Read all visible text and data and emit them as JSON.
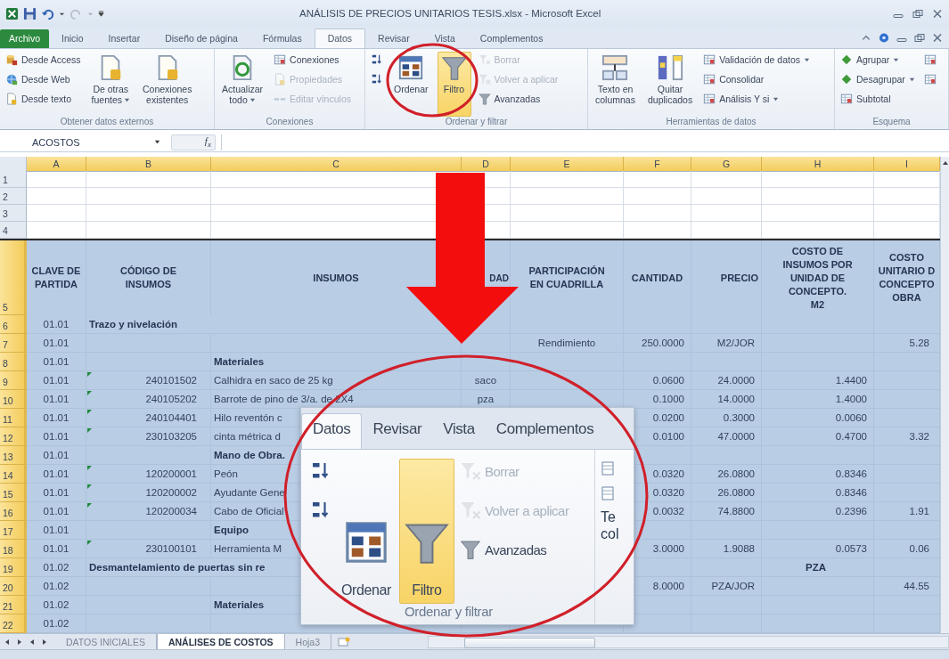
{
  "title_bar": {
    "title": "ANÁLISIS DE PRECIOS UNITARIOS TESIS.xlsx - Microsoft Excel"
  },
  "menu_tabs": [
    {
      "label": "Archivo",
      "kind": "file",
      "selected": false
    },
    {
      "label": "Inicio",
      "kind": "tab",
      "selected": false
    },
    {
      "label": "Insertar",
      "kind": "tab",
      "selected": false
    },
    {
      "label": "Diseño de página",
      "kind": "tab",
      "selected": false
    },
    {
      "label": "Fórmulas",
      "kind": "tab",
      "selected": false
    },
    {
      "label": "Datos",
      "kind": "tab",
      "selected": true
    },
    {
      "label": "Revisar",
      "kind": "tab",
      "selected": false
    },
    {
      "label": "Vista",
      "kind": "tab",
      "selected": false
    },
    {
      "label": "Complementos",
      "kind": "tab",
      "selected": false
    }
  ],
  "ribbon": [
    {
      "label": "Obtener datos externos",
      "items": [
        {
          "kind": "small",
          "label": [
            "Desde Access"
          ],
          "dropdown": false,
          "disabled": false,
          "selected": false
        },
        {
          "kind": "small",
          "label": [
            "Desde Web"
          ],
          "dropdown": false,
          "disabled": false,
          "selected": false
        },
        {
          "kind": "small",
          "label": [
            "Desde texto"
          ],
          "dropdown": false,
          "disabled": false,
          "selected": false
        },
        {
          "kind": "large",
          "label": [
            "De otras",
            "fuentes"
          ],
          "dropdown": true,
          "disabled": false,
          "selected": false
        },
        {
          "kind": "large",
          "label": [
            "Conexiones",
            "existentes"
          ],
          "dropdown": false,
          "disabled": false,
          "selected": false
        }
      ]
    },
    {
      "label": "Conexiones",
      "items": [
        {
          "kind": "large",
          "label": [
            "Actualizar",
            "todo"
          ],
          "dropdown": true,
          "disabled": false,
          "selected": false
        },
        {
          "kind": "small",
          "label": [
            "Conexiones"
          ],
          "dropdown": false,
          "disabled": false,
          "selected": false
        },
        {
          "kind": "small",
          "label": [
            "Propiedades"
          ],
          "dropdown": false,
          "disabled": true,
          "selected": false
        },
        {
          "kind": "small",
          "label": [
            "Editar vínculos"
          ],
          "dropdown": false,
          "disabled": true,
          "selected": false
        }
      ]
    },
    {
      "label": "Ordenar y filtrar",
      "items": [
        {
          "kind": "icon",
          "dropdown": false,
          "disabled": false,
          "selected": false
        },
        {
          "kind": "icon",
          "dropdown": false,
          "disabled": false,
          "selected": false
        },
        {
          "kind": "large",
          "label": [
            "Ordenar"
          ],
          "dropdown": false,
          "disabled": false,
          "selected": false
        },
        {
          "kind": "large",
          "label": [
            "Filtro"
          ],
          "dropdown": false,
          "disabled": false,
          "selected": true
        },
        {
          "kind": "small",
          "label": [
            "Borrar"
          ],
          "dropdown": false,
          "disabled": true,
          "selected": false
        },
        {
          "kind": "small",
          "label": [
            "Volver a aplicar"
          ],
          "dropdown": false,
          "disabled": true,
          "selected": false
        },
        {
          "kind": "small",
          "label": [
            "Avanzadas"
          ],
          "dropdown": false,
          "disabled": false,
          "selected": false
        }
      ]
    },
    {
      "label": "Herramientas de datos",
      "items": [
        {
          "kind": "large",
          "label": [
            "Texto en",
            "columnas"
          ],
          "dropdown": false,
          "disabled": false,
          "selected": false
        },
        {
          "kind": "large",
          "label": [
            "Quitar",
            "duplicados"
          ],
          "dropdown": false,
          "disabled": false,
          "selected": false
        },
        {
          "kind": "small",
          "label": [
            "Validación de datos"
          ],
          "dropdown": true,
          "disabled": false,
          "selected": false
        },
        {
          "kind": "small",
          "label": [
            "Consolidar"
          ],
          "dropdown": false,
          "disabled": false,
          "selected": false
        },
        {
          "kind": "small",
          "label": [
            "Análisis Y si"
          ],
          "dropdown": true,
          "disabled": false,
          "selected": false
        }
      ]
    },
    {
      "label": "Esquema",
      "items": [
        {
          "kind": "small",
          "label": [
            "Agrupar"
          ],
          "dropdown": true,
          "disabled": false,
          "selected": false
        },
        {
          "kind": "small",
          "label": [
            "Desagrupar"
          ],
          "dropdown": true,
          "disabled": false,
          "selected": false
        },
        {
          "kind": "small",
          "label": [
            "Subtotal"
          ],
          "dropdown": false,
          "disabled": false,
          "selected": false
        },
        {
          "kind": "icon",
          "dropdown": false,
          "disabled": false,
          "selected": false
        },
        {
          "kind": "icon",
          "dropdown": false,
          "disabled": false,
          "selected": false
        }
      ]
    }
  ],
  "formula_bar": {
    "name_box": "ACOSTOS",
    "fx": "f$_{x}$"
  },
  "sheet": {
    "columns": [
      {
        "letter": "A",
        "selected": true
      },
      {
        "letter": "B",
        "selected": true
      },
      {
        "letter": "C",
        "selected": true
      },
      {
        "letter": "D",
        "selected": true
      },
      {
        "letter": "E",
        "selected": true
      },
      {
        "letter": "F",
        "selected": true
      },
      {
        "letter": "G",
        "selected": true
      },
      {
        "letter": "H",
        "selected": true
      },
      {
        "letter": "I",
        "selected": true
      }
    ],
    "rows": [
      {
        "number": "1",
        "kind": "blank",
        "selected": false,
        "flagged": false
      },
      {
        "number": "2",
        "kind": "blank",
        "selected": false,
        "flagged": false
      },
      {
        "number": "3",
        "kind": "blank",
        "selected": false,
        "flagged": false
      },
      {
        "number": "4",
        "kind": "blank",
        "selected": false,
        "flagged": false
      },
      {
        "number": "5",
        "kind": "header",
        "selected": true,
        "flagged": false,
        "cells": {
          "A": "CLAVE DE\nPARTIDA",
          "B": "CÓDIGO DE\nINSUMOS",
          "C": "INSUMOS",
          "D": "DAD",
          "E": "PARTICIPACIÓN\nEN CUADRILLA",
          "F": "CANTIDAD",
          "G": "PRECIO",
          "H": "COSTO DE\nINSUMOS POR\nUNIDAD DE\nCONCEPTO.\nM2",
          "I": "COSTO\nUNITARIO D\nCONCEPTO\nOBRA"
        }
      },
      {
        "number": "6",
        "kind": "section",
        "selected": true,
        "flagged": false,
        "cells": {
          "A": "01.01",
          "B": "Trazo y nivelación"
        }
      },
      {
        "number": "7",
        "kind": "data",
        "selected": true,
        "flagged": false,
        "cells": {
          "A": "01.01",
          "E": "Rendimiento",
          "F": "250.0000",
          "G": "M2/JOR",
          "I": "5.28"
        }
      },
      {
        "number": "8",
        "kind": "group",
        "selected": true,
        "flagged": false,
        "cells": {
          "A": "01.01",
          "C": "Materiales"
        }
      },
      {
        "number": "9",
        "kind": "data",
        "selected": true,
        "flagged": true,
        "cells": {
          "A": "01.01",
          "B": "240101502",
          "C": "Calhidra en saco de 25 kg",
          "D": "saco",
          "F": "0.0600",
          "G": "24.0000",
          "H": "1.4400"
        }
      },
      {
        "number": "10",
        "kind": "data",
        "selected": true,
        "flagged": true,
        "cells": {
          "A": "01.01",
          "B": "240105202",
          "C": "Barrote de pino de 3/a. de 2X4",
          "D": "pza",
          "F": "0.1000",
          "G": "14.0000",
          "H": "1.4000"
        }
      },
      {
        "number": "11",
        "kind": "data",
        "selected": true,
        "flagged": true,
        "cells": {
          "A": "01.01",
          "B": "240104401",
          "C": "Hilo reventón c",
          "F": "0.0200",
          "G": "0.3000",
          "H": "0.0060"
        }
      },
      {
        "number": "12",
        "kind": "data",
        "selected": true,
        "flagged": true,
        "cells": {
          "A": "01.01",
          "B": "230103205",
          "C": "cinta métrica d",
          "F": "0.0100",
          "G": "47.0000",
          "H": "0.4700",
          "I": "3.32"
        }
      },
      {
        "number": "13",
        "kind": "group",
        "selected": true,
        "flagged": false,
        "cells": {
          "A": "01.01",
          "C": "Mano de Obra."
        }
      },
      {
        "number": "14",
        "kind": "data",
        "selected": true,
        "flagged": true,
        "cells": {
          "A": "01.01",
          "B": "120200001",
          "C": "Peón",
          "F": "0.0320",
          "G": "26.0800",
          "H": "0.8346"
        }
      },
      {
        "number": "15",
        "kind": "data",
        "selected": true,
        "flagged": true,
        "cells": {
          "A": "01.01",
          "B": "120200002",
          "C": "Ayudante Gene",
          "F": "0.0320",
          "G": "26.0800",
          "H": "0.8346"
        }
      },
      {
        "number": "16",
        "kind": "data",
        "selected": true,
        "flagged": true,
        "cells": {
          "A": "01.01",
          "B": "120200034",
          "C": "Cabo de Oficial",
          "F": "0.0032",
          "G": "74.8800",
          "H": "0.2396",
          "I": "1.91"
        }
      },
      {
        "number": "17",
        "kind": "group",
        "selected": true,
        "flagged": false,
        "cells": {
          "A": "01.01",
          "C": "Equipo"
        }
      },
      {
        "number": "18",
        "kind": "data",
        "selected": true,
        "flagged": true,
        "cells": {
          "A": "01.01",
          "B": "230100101",
          "C": "Herramienta M",
          "F": "3.0000",
          "G": "1.9088",
          "H": "0.0573",
          "I": "0.06"
        }
      },
      {
        "number": "19",
        "kind": "section",
        "selected": true,
        "flagged": false,
        "cells": {
          "A": "01.02",
          "B": "Desmantelamiento de puertas sin re",
          "H": "PZA"
        }
      },
      {
        "number": "20",
        "kind": "data",
        "selected": true,
        "flagged": false,
        "cells": {
          "A": "01.02",
          "F": "8.0000",
          "G": "PZA/JOR",
          "I": "44.55"
        }
      },
      {
        "number": "21",
        "kind": "group",
        "selected": true,
        "flagged": false,
        "cells": {
          "A": "01.02",
          "C": "Materiales"
        }
      },
      {
        "number": "22",
        "kind": "data",
        "selected": true,
        "flagged": false,
        "cells": {
          "A": "01.02"
        }
      }
    ]
  },
  "sheet_tabs": [
    {
      "label": "DATOS INICIALES",
      "selected": false
    },
    {
      "label": "ANÁLISES DE COSTOS",
      "selected": true
    },
    {
      "label": "Hoja3",
      "selected": false
    }
  ],
  "inset": {
    "tabs": [
      {
        "label": "Datos",
        "selected": true
      },
      {
        "label": "Revisar",
        "selected": false
      },
      {
        "label": "Vista",
        "selected": false
      },
      {
        "label": "Complementos",
        "selected": false
      }
    ],
    "group": {
      "label": "Ordenar y filtrar",
      "items": [
        {
          "kind": "icon",
          "dropdown": false,
          "disabled": false,
          "selected": false
        },
        {
          "kind": "icon",
          "dropdown": false,
          "disabled": false,
          "selected": false
        },
        {
          "kind": "large",
          "label": [
            "Ordenar"
          ],
          "dropdown": false,
          "disabled": false,
          "selected": false
        },
        {
          "kind": "large",
          "label": [
            "Filtro"
          ],
          "dropdown": false,
          "disabled": false,
          "selected": true
        },
        {
          "kind": "small",
          "label": [
            "Borrar"
          ],
          "dropdown": false,
          "disabled": true,
          "selected": false
        },
        {
          "kind": "small",
          "label": [
            "Volver a aplicar"
          ],
          "dropdown": false,
          "disabled": true,
          "selected": false
        },
        {
          "kind": "small",
          "label": [
            "Avanzadas"
          ],
          "dropdown": false,
          "disabled": false,
          "selected": false
        }
      ]
    },
    "next_group_text": [
      "Te",
      "col"
    ]
  }
}
